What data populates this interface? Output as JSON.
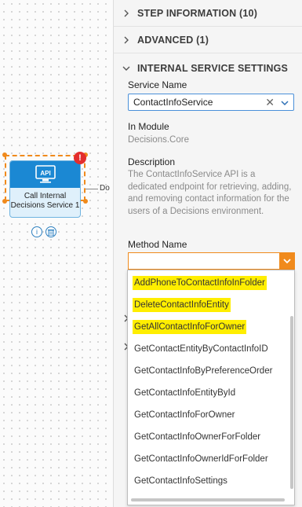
{
  "canvas": {
    "step_label": "Call Internal Decisions Service 1",
    "connector_text": "Do",
    "api_icon_text": "API",
    "error_badge": "!"
  },
  "panel": {
    "sections": {
      "step_information": "STEP INFORMATION (10)",
      "advanced": "ADVANCED (1)",
      "internal_service_settings": "INTERNAL SERVICE SETTINGS"
    },
    "service_name": {
      "label": "Service Name",
      "value": "ContactInfoService"
    },
    "in_module": {
      "label": "In Module",
      "value": "Decisions.Core"
    },
    "description": {
      "label": "Description",
      "text": "The ContactInfoService API is a dedicated endpoint for retrieving, adding, and removing contact information for the users of a Decisions environment."
    },
    "method_name": {
      "label": "Method Name",
      "value": ""
    }
  },
  "dropdown": {
    "options": [
      {
        "label": "AddPhoneToContactInfoInFolder",
        "highlighted": true
      },
      {
        "label": "DeleteContactInfoEntity",
        "highlighted": true
      },
      {
        "label": "GetAllContactInfoForOwner",
        "highlighted": true
      },
      {
        "label": "GetContactEntityByContactInfoID",
        "highlighted": false
      },
      {
        "label": "GetContactInfoByPreferenceOrder",
        "highlighted": false
      },
      {
        "label": "GetContactInfoEntityById",
        "highlighted": false
      },
      {
        "label": "GetContactInfoForOwner",
        "highlighted": false
      },
      {
        "label": "GetContactInfoOwnerForFolder",
        "highlighted": false
      },
      {
        "label": "GetContactInfoOwnerIdForFolder",
        "highlighted": false
      },
      {
        "label": "GetContactInfoSettings",
        "highlighted": false
      }
    ]
  },
  "colors": {
    "accent_orange": "#f08a1c",
    "accent_blue": "#1b88d3",
    "highlight_yellow": "#ffee00",
    "error_red": "#e32d2d"
  },
  "icons": [
    "chevron-right-icon",
    "chevron-down-icon",
    "clear-icon",
    "info-icon",
    "delete-icon",
    "api-icon",
    "error-icon"
  ]
}
